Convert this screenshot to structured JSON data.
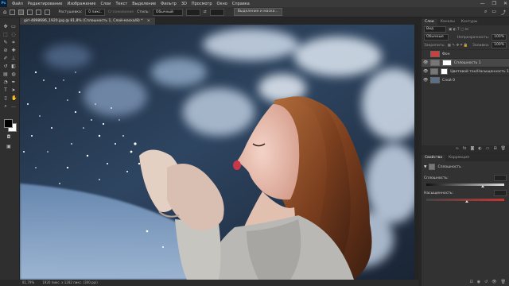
{
  "menubar": {
    "logo": "Ps",
    "items": [
      "Файл",
      "Редактирование",
      "Изображение",
      "Слои",
      "Текст",
      "Выделение",
      "Фильтр",
      "3D",
      "Просмотр",
      "Окно",
      "Справка"
    ],
    "window_controls": [
      "—",
      "❐",
      "✕"
    ]
  },
  "options": {
    "feather_label": "Растушевка:",
    "feather_value": "0 пикс.",
    "antialias_label": "Сглаживание",
    "style_label": "Стиль:",
    "style_value": "Обычный",
    "select_mask_label": "Выделение и маска..."
  },
  "document": {
    "tab_title": "girl-4898686_1920.jpg @ 81,8% (Сплошность 1, Слой-маска/8) *"
  },
  "status": {
    "zoom": "81,79%",
    "doc_info": "1920 пикс. x 1282 пикс. (300 ppi)"
  },
  "layers_panel": {
    "tabs": [
      "Слои",
      "Каналы",
      "Контуры"
    ],
    "search_placeholder": "Вид",
    "blend_mode": "Обычные",
    "opacity_label": "Непрозрачность:",
    "opacity_value": "100%",
    "lock_label": "Закрепить:",
    "fill_label": "Заливка:",
    "fill_value": "100%",
    "layers": [
      {
        "name": "Фон",
        "visible": false,
        "thumb_color": "#cf3d3d"
      },
      {
        "name": "Сплошность 1",
        "visible": true,
        "thumb_color": "#ffffff"
      },
      {
        "name": "Цветовой тон/Насыщенность 1",
        "visible": true,
        "thumb_color": "#ffffff"
      },
      {
        "name": "Слой 0",
        "visible": true,
        "thumb_color": "#5b6f8a"
      }
    ]
  },
  "properties_panel": {
    "tabs": [
      "Свойства",
      "Коррекция"
    ],
    "title": "Сплошность",
    "solidity_label": "Сплошность:",
    "solidity_value": "",
    "saturation_label": "Насыщенность:",
    "saturation_value": ""
  },
  "colors": {
    "accent": "#31a8ff",
    "panel_bg": "#323232",
    "app_bg": "#282828"
  }
}
